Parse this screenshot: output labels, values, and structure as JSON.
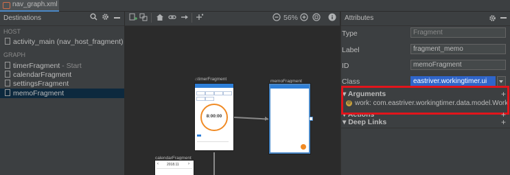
{
  "tab": {
    "label": "nav_graph.xml"
  },
  "destinations_panel": {
    "title": "Destinations",
    "host_section": "HOST",
    "host_item": "activity_main (nav_host_fragment)",
    "graph_section": "GRAPH",
    "items": [
      {
        "label": "timerFragment",
        "suffix": " - Start"
      },
      {
        "label": "calendarFragment",
        "suffix": ""
      },
      {
        "label": "settingsFragment",
        "suffix": ""
      },
      {
        "label": "memoFragment",
        "suffix": ""
      }
    ]
  },
  "toolbar": {
    "zoom": "56%"
  },
  "canvas": {
    "timer_title": "timerFragment",
    "timer_time": "8:00:00",
    "memo_title": "memoFragment",
    "calendar_title": "calendarFragment",
    "calendar_month": "2018.11"
  },
  "attributes_panel": {
    "title": "Attributes",
    "rows": [
      {
        "label": "Type",
        "value": "Fragment"
      },
      {
        "label": "Label",
        "value": "fragment_memo"
      },
      {
        "label": "ID",
        "value": "memoFragment"
      },
      {
        "label": "Class",
        "value": "eastriver.workingtimer.ui"
      }
    ],
    "arguments_title": "Arguments",
    "argument_item": "work: com.eastriver.workingtimer.data.model.Work",
    "actions_title": "Actions",
    "deep_links_title": "Deep Links"
  },
  "colors": {
    "selection": "#0d293e",
    "highlight": "#e3141b",
    "accent": "#2e7fd8",
    "timer_ring": "#f08a24"
  }
}
